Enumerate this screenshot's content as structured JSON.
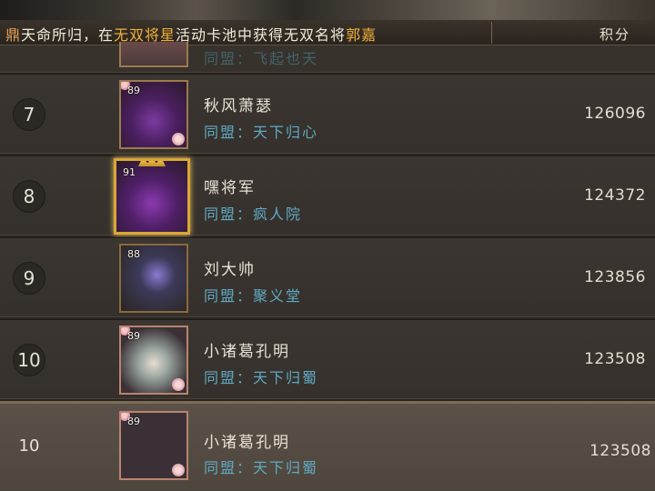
{
  "ticker": {
    "prefix": "鼎",
    "text_parts": [
      "天命所归，在",
      "无双将星",
      "活动卡池中获得无双名将",
      "郭嘉"
    ],
    "score_header": "积分"
  },
  "partial_row": {
    "alliance": "同盟：飞起也天"
  },
  "rows": [
    {
      "rank": "7",
      "level": "89",
      "name": "秋风萧瑟",
      "alliance": "同盟：天下归心",
      "score": "126096"
    },
    {
      "rank": "8",
      "level": "91",
      "name": "嘿将军",
      "alliance": "同盟：疯人院",
      "score": "124372"
    },
    {
      "rank": "9",
      "level": "88",
      "name": "刘大帅",
      "alliance": "同盟：聚义堂",
      "score": "123856"
    },
    {
      "rank": "10",
      "level": "89",
      "name": "小诸葛孔明",
      "alliance": "同盟：天下归蜀",
      "score": "123508"
    }
  ],
  "self_row": {
    "rank": "10",
    "level": "89",
    "name": "小诸葛孔明",
    "alliance": "同盟：天下归蜀",
    "score": "123508"
  }
}
